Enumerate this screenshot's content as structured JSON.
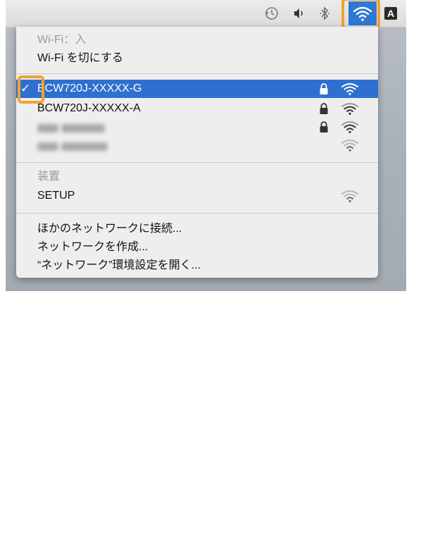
{
  "menubar": {
    "icons": [
      "time-machine-icon",
      "volume-icon",
      "bluetooth-icon",
      "wifi-icon",
      "input-source-icon"
    ],
    "input_source_label": "A"
  },
  "wifi_menu": {
    "status_label": "Wi-Fi：入",
    "toggle_label": "Wi-Fi を切にする",
    "networks": [
      {
        "name": "BCW720J-XXXXX-G",
        "selected": true,
        "locked": true
      },
      {
        "name": "BCW720J-XXXXX-A",
        "selected": false,
        "locked": true
      },
      {
        "name": "",
        "selected": false,
        "locked": true,
        "obscured": true
      },
      {
        "name": "",
        "selected": false,
        "locked": false,
        "obscured": true
      }
    ],
    "devices_header": "装置",
    "device_name": "SETUP",
    "actions": {
      "join_other": "ほかのネットワークに接続...",
      "create_network": "ネットワークを作成...",
      "open_prefs": "“ネットワーク”環境設定を開く..."
    },
    "check_mark": "✓"
  },
  "colors": {
    "highlight": "#f2a22c",
    "selected_row": "#2f6fd0",
    "menu_bg": "#eeeeee"
  }
}
